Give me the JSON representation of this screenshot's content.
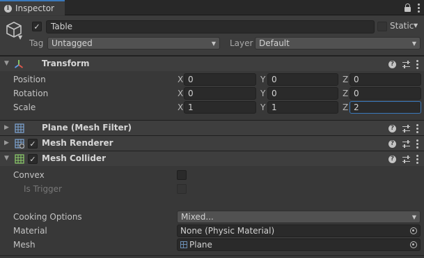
{
  "window": {
    "tab_label": "Inspector"
  },
  "header": {
    "active": true,
    "name": "Table",
    "static_label": "Static",
    "static_checked": false,
    "tag_label": "Tag",
    "tag_value": "Untagged",
    "layer_label": "Layer",
    "layer_value": "Default"
  },
  "components": {
    "transform": {
      "title": "Transform",
      "rows": {
        "position": {
          "label": "Position",
          "x": "0",
          "y": "0",
          "z": "0"
        },
        "rotation": {
          "label": "Rotation",
          "x": "0",
          "y": "0",
          "z": "0"
        },
        "scale": {
          "label": "Scale",
          "x": "1",
          "y": "1",
          "z": "2"
        }
      },
      "axes": {
        "x": "X",
        "y": "Y",
        "z": "Z"
      }
    },
    "mesh_filter": {
      "title": "Plane (Mesh Filter)"
    },
    "mesh_renderer": {
      "title": "Mesh Renderer",
      "enabled": true
    },
    "mesh_collider": {
      "title": "Mesh Collider",
      "enabled": true,
      "convex_label": "Convex",
      "is_trigger_label": "Is Trigger",
      "cooking_options_label": "Cooking Options",
      "cooking_options_value": "Mixed...",
      "material_label": "Material",
      "material_value": "None (Physic Material)",
      "mesh_label": "Mesh",
      "mesh_value": "Plane"
    }
  },
  "icons": {
    "tab": "info-icon",
    "lock": "lock-icon",
    "menu": "kebab-menu-icon",
    "object": "cube-icon",
    "transform": "transform-axes-icon",
    "mesh_filter": "mesh-grid-icon",
    "mesh_renderer": "mesh-renderer-icon",
    "mesh_collider": "collider-grid-icon",
    "help": "help-icon",
    "presets": "presets-icon",
    "object_picker": "object-picker-icon"
  },
  "colors": {
    "accent": "#3a79bb",
    "panel": "#383838",
    "header": "#3e3e3e",
    "field": "#2a2a2a",
    "collider_green": "#8fd16c"
  }
}
